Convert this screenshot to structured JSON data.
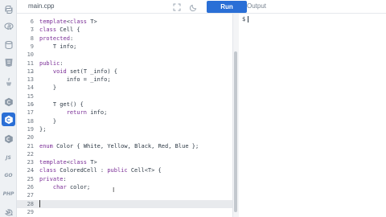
{
  "file_tab": "main.cpp",
  "toolbar": {
    "run_label": "Run",
    "fullscreen_icon": "fullscreen-icon",
    "theme_icon": "moon-icon"
  },
  "output": {
    "title": "Output",
    "prompt": "$"
  },
  "sidebar": {
    "items": [
      {
        "name": "python-icon",
        "label": ""
      },
      {
        "name": "r-icon",
        "label": ""
      },
      {
        "name": "sql-icon",
        "label": ""
      },
      {
        "name": "html-icon",
        "label": ""
      },
      {
        "name": "java-icon",
        "label": ""
      },
      {
        "name": "c-icon",
        "label": ""
      },
      {
        "name": "cpp-icon",
        "label": "",
        "active": true
      },
      {
        "name": "csharp-icon",
        "label": ""
      },
      {
        "name": "js-icon",
        "label": "JS"
      },
      {
        "name": "go-icon",
        "label": "GO"
      },
      {
        "name": "php-icon",
        "label": "PHP"
      },
      {
        "name": "swift-icon",
        "label": ""
      }
    ]
  },
  "editor": {
    "lines": [
      {
        "n": "6",
        "fold": "",
        "text": "template<class T>"
      },
      {
        "n": "7",
        "fold": "v",
        "text": "class Cell {"
      },
      {
        "n": "8",
        "fold": "",
        "text": "protected:"
      },
      {
        "n": "9",
        "fold": "",
        "text": "    T info;"
      },
      {
        "n": "10",
        "fold": "",
        "text": ""
      },
      {
        "n": "11",
        "fold": "",
        "text": "public:"
      },
      {
        "n": "12",
        "fold": "v",
        "text": "    void set(T _info) {"
      },
      {
        "n": "13",
        "fold": "",
        "text": "        info = _info;"
      },
      {
        "n": "14",
        "fold": "",
        "text": "    }"
      },
      {
        "n": "15",
        "fold": "",
        "text": ""
      },
      {
        "n": "16",
        "fold": "v",
        "text": "    T get() {"
      },
      {
        "n": "17",
        "fold": "",
        "text": "        return info;"
      },
      {
        "n": "18",
        "fold": "",
        "text": "    }"
      },
      {
        "n": "19",
        "fold": "",
        "text": "};"
      },
      {
        "n": "20",
        "fold": "",
        "text": ""
      },
      {
        "n": "21",
        "fold": "",
        "text": "enum Color { White, Yellow, Black, Red, Blue };"
      },
      {
        "n": "22",
        "fold": "",
        "text": ""
      },
      {
        "n": "23",
        "fold": "",
        "text": "template<class T>"
      },
      {
        "n": "24",
        "fold": "v",
        "text": "class ColoredCell : public Cell<T> {"
      },
      {
        "n": "25",
        "fold": "",
        "text": "private:"
      },
      {
        "n": "26",
        "fold": "",
        "text": "    char color;"
      },
      {
        "n": "27",
        "fold": "",
        "text": ""
      },
      {
        "n": "28",
        "fold": "",
        "text": "",
        "current": true
      },
      {
        "n": "29",
        "fold": "",
        "text": ""
      }
    ]
  },
  "colors": {
    "accent": "#2a6fd6",
    "keyword": "#7a2d96",
    "current_line": "#e8eaed"
  }
}
